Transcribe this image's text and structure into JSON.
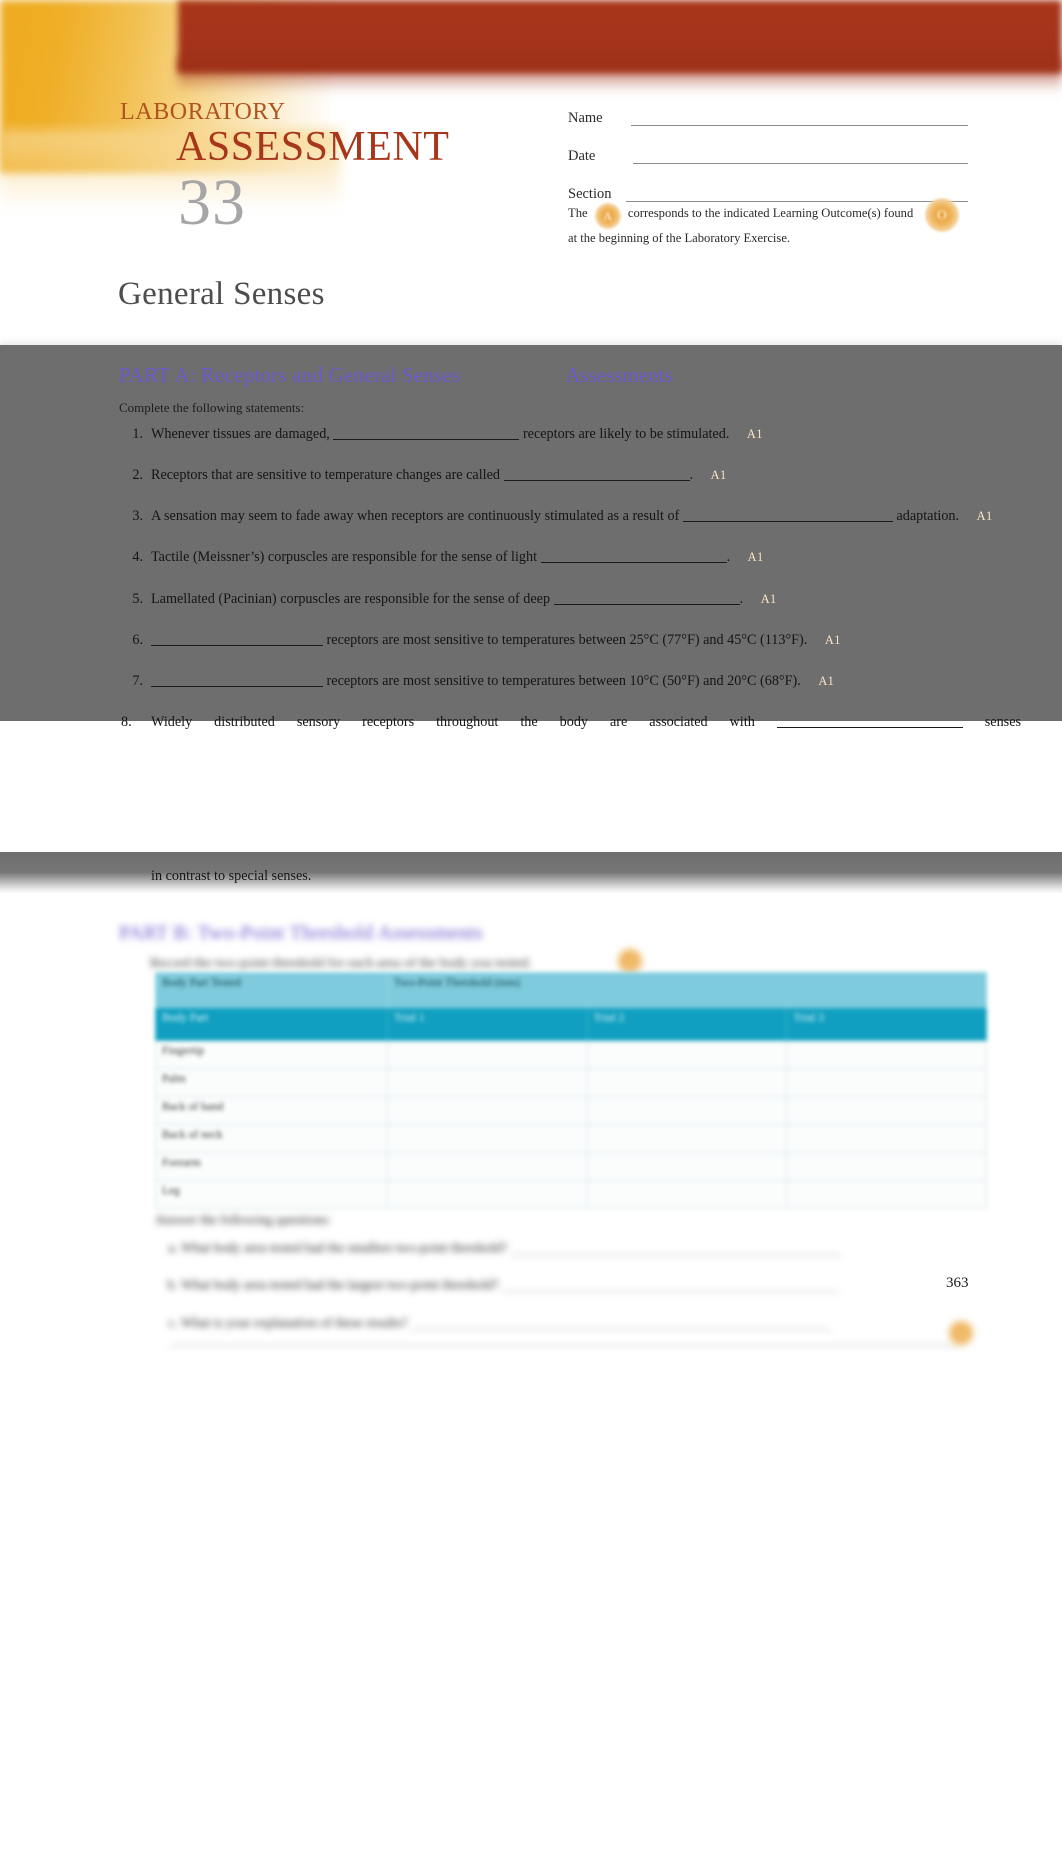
{
  "masthead": {
    "kicker": "LABORATORY",
    "word": "ASSESSMENT",
    "number": "33",
    "doc_title": "General Senses"
  },
  "identity": {
    "name_label": "Name",
    "date_label": "Date",
    "section_label": "Section",
    "learning_outcome_note_pre": "The",
    "learning_outcome_badge": "A",
    "learning_outcome_note_post": "corresponds to the indicated Learning Outcome(s) found at the beginning of the Laboratory Exercise.",
    "outcome_badge_right": "O"
  },
  "part_a": {
    "title": "PART A: Receptors and General Senses",
    "assessments_label": "Assessments",
    "instruction": "Complete the following statements:",
    "tag_label": "A1",
    "questions": [
      {
        "pre": "Whenever tissues are damaged,",
        "post": "receptors are likely to be stimulated.",
        "tag": "A1"
      },
      {
        "pre": "Receptors that are sensitive to temperature changes are called",
        "post": ".",
        "tag": "A1"
      },
      {
        "pre": "A sensation may seem to fade away when receptors are continuously stimulated as a result of",
        "post": "adaptation.",
        "tag": "A1"
      },
      {
        "pre": "Tactile (Meissner’s) corpuscles are responsible for the sense of light",
        "post": ".",
        "tag": "A1"
      },
      {
        "pre": "Lamellated (Pacinian) corpuscles are responsible for the sense of deep",
        "post": ".",
        "tag": "A1"
      },
      {
        "pre": "",
        "post": "receptors are most sensitive to temperatures between 25°C (77°F) and 45°C (113°F).",
        "tag": "A1"
      },
      {
        "pre": "",
        "post": "receptors are most sensitive to temperatures between 10°C (50°F) and 20°C (68°F).",
        "tag": "A1"
      },
      {
        "pre": "Widely distributed sensory receptors throughout the body are associated with",
        "post": "senses",
        "tag": ""
      }
    ],
    "tail_line": "in contrast to special senses."
  },
  "part_b": {
    "title": "PART B: Two-Point Threshold Assessments",
    "instruction": "Record the two-point threshold for each area of the body you tested.",
    "badge": "A",
    "table": {
      "header_top": [
        "Body Part Tested",
        "Two-Point Threshold (mm)",
        "",
        ""
      ],
      "header_sub": [
        "Body Part",
        "Trial 1",
        "Trial 2",
        "Trial 3"
      ],
      "rows": [
        [
          "Fingertip",
          "",
          "",
          ""
        ],
        [
          "Palm",
          "",
          "",
          ""
        ],
        [
          "Back of hand",
          "",
          "",
          ""
        ],
        [
          "Back of neck",
          "",
          "",
          ""
        ],
        [
          "Forearm",
          "",
          "",
          ""
        ],
        [
          "Leg",
          "",
          "",
          ""
        ]
      ]
    },
    "questions_title": "Answer the following questions:",
    "questions": [
      "What body area tested had the smallest two-point threshold?",
      "What body area tested had the largest two-point threshold?",
      "What is your explanation of these results?"
    ],
    "badge_bottom": "A"
  },
  "footer": {
    "page_number": "363"
  },
  "colors": {
    "gold": "#eeab1e",
    "brick": "#a8361a",
    "kicker": "#b0541f",
    "lab_number_gray": "#a6a6a6",
    "heading_purple": "#6a5acd",
    "overlay_gray": "#6e6e6e",
    "table_band_light": "#7ecbdd",
    "table_band_dark": "#109fc0",
    "badge_orange": "#e8a13c",
    "tag_cream": "#fbe3c4"
  }
}
